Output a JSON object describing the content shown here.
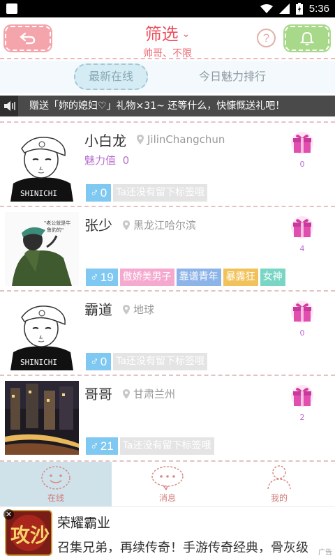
{
  "status_bar": {
    "time": "5:36"
  },
  "header": {
    "title": "筛选",
    "subtitle": "帅哥、不限"
  },
  "tabs": [
    {
      "label": "最新在线",
      "active": true
    },
    {
      "label": "今日魅力排行",
      "active": false
    }
  ],
  "ticker": {
    "text": "赠送「妳的媳妇♡」礼物×31~ 还等什么，快慷慨送礼吧！"
  },
  "users": [
    {
      "name": "小白龙",
      "location": "JilinChangchun",
      "charm_label": "魅力值",
      "charm_value": "0",
      "gift_count": "0",
      "gender_symbol": "♂",
      "age": "0",
      "tags": [
        {
          "text": "Ta还没有留下标签哦",
          "color": "#e4e4e4"
        }
      ],
      "avatar": "boy-cap-sketch-avatar"
    },
    {
      "name": "张少",
      "location": "黑龙江哈尔滨",
      "charm_label": "",
      "charm_value": "",
      "gift_count": "4",
      "gender_symbol": "♂",
      "age": "19",
      "tags": [
        {
          "text": "傲娇美男子",
          "color": "#f5a9cf"
        },
        {
          "text": "靠谱青年",
          "color": "#8db4e8"
        },
        {
          "text": "暴露狂",
          "color": "#f2c25a"
        },
        {
          "text": "女神",
          "color": "#79d6c4"
        }
      ],
      "avatar": "green-jacket-avatar"
    },
    {
      "name": "霸道",
      "location": "地球",
      "charm_label": "",
      "charm_value": "",
      "gift_count": "0",
      "gender_symbol": "♂",
      "age": "0",
      "tags": [
        {
          "text": "Ta还没有留下标签哦",
          "color": "#e4e4e4"
        }
      ],
      "avatar": "boy-cap-sketch-avatar"
    },
    {
      "name": "哥哥",
      "location": "甘肃兰州",
      "charm_label": "",
      "charm_value": "",
      "gift_count": "2",
      "gender_symbol": "♂",
      "age": "21",
      "tags": [
        {
          "text": "Ta还没有留下标签哦",
          "color": "#e4e4e4"
        }
      ],
      "avatar": "city-night-avatar"
    }
  ],
  "bottom_nav": [
    {
      "label": "在线",
      "icon": "smiley-icon",
      "active": true
    },
    {
      "label": "消息",
      "icon": "speech-bubble-icon",
      "active": false
    },
    {
      "label": "我的",
      "icon": "person-icon",
      "active": false
    }
  ],
  "ad": {
    "title": "荣耀霸业",
    "description": "召集兄弟，再续传奇！手游传奇经典，骨灰级",
    "logo_text": "攻沙",
    "mark": "广告"
  },
  "colors": {
    "accent_pink": "#ee4f5d",
    "back_button": "#f4a4ab",
    "bell_button": "#a8d98a",
    "charm": "#b86fd2",
    "gender_badge": "#7ec8f2"
  }
}
